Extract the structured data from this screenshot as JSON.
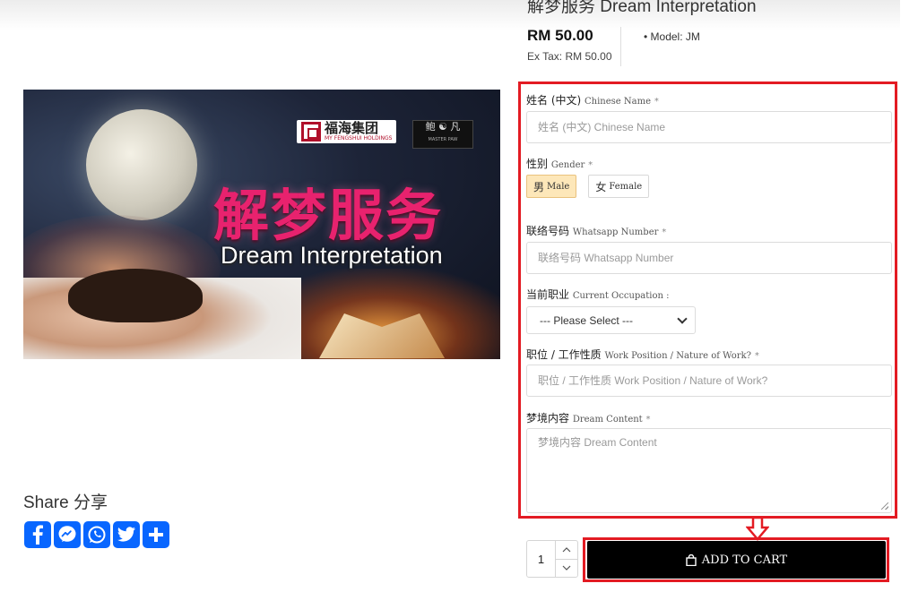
{
  "product": {
    "title": "解梦服务 Dream Interpretation",
    "price": "RM 50.00",
    "ex_tax": "Ex Tax: RM 50.00",
    "model": "• Model: JM"
  },
  "banner": {
    "title_cn": "解梦服务",
    "title_en": "Dream Interpretation",
    "logo_cn": "福海集团",
    "logo_en": "MY FENGSHUI HOLDINGS",
    "logo2_cn": "鲍 ☯ 凡",
    "logo2_en": "MASTER PAW"
  },
  "share": {
    "title": "Share 分享",
    "buttons": [
      {
        "icon": "facebook-icon",
        "glyph": "f",
        "color": "#0866ff"
      },
      {
        "icon": "messenger-icon",
        "glyph": "m",
        "color": "#0866ff"
      },
      {
        "icon": "whatsapp-icon",
        "glyph": "w",
        "color": "#0866ff"
      },
      {
        "icon": "twitter-icon",
        "glyph": "t",
        "color": "#0866ff"
      },
      {
        "icon": "add-share-icon",
        "glyph": "+",
        "color": "#0866ff"
      }
    ]
  },
  "form": {
    "chinese_name": {
      "label_cn": "姓名 (中文)",
      "label_en": "Chinese Name",
      "required": "*",
      "placeholder": "姓名 (中文) Chinese Name"
    },
    "gender": {
      "label_cn": "性别",
      "label_en": "Gender",
      "required": "*",
      "options": [
        {
          "cn": "男",
          "en": "Male",
          "selected": true
        },
        {
          "cn": "女",
          "en": "Female",
          "selected": false
        }
      ]
    },
    "whatsapp": {
      "label_cn": "联络号码",
      "label_en": "Whatsapp Number",
      "required": "*",
      "placeholder": "联络号码 Whatsapp Number"
    },
    "occupation": {
      "label_cn": "当前职业",
      "label_en": "Current Occupation :",
      "selected": "--- Please Select ---"
    },
    "position": {
      "label_cn": "职位 / 工作性质",
      "label_en": "Work Position / Nature of Work?",
      "required": "*",
      "placeholder": "职位 / 工作性质 Work Position / Nature of Work?"
    },
    "dream": {
      "label_cn": "梦境内容",
      "label_en": "Dream Content",
      "required": "*",
      "placeholder": "梦境内容 Dream Content"
    }
  },
  "cart": {
    "quantity": "1",
    "add_label": "ADD TO CART"
  },
  "colors": {
    "highlight_red": "#e31b23",
    "selected_option": "#fde7b9",
    "share_blue": "#0866ff"
  }
}
